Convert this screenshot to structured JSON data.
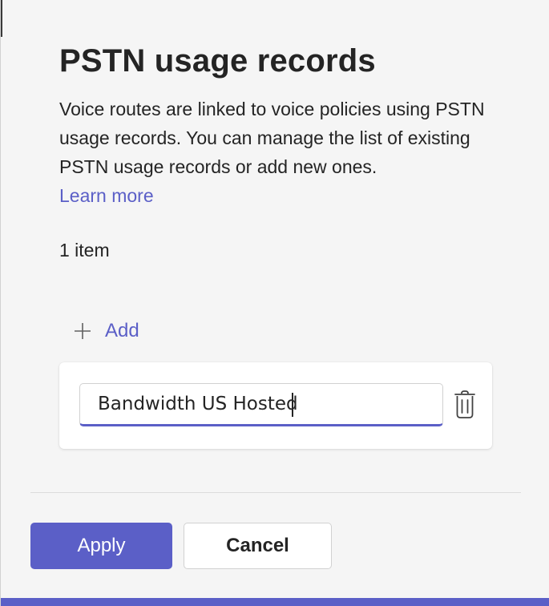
{
  "dialog": {
    "title": "PSTN usage records",
    "description": "Voice routes are linked to voice policies using PSTN usage records. You can manage the list of existing PSTN usage records or add new ones.",
    "learn_more_label": "Learn more",
    "item_count_label": "1 item"
  },
  "toolbar": {
    "add_label": "Add",
    "add_icon": "plus-icon"
  },
  "records": [
    {
      "value": "Bandwidth US Hosted",
      "delete_icon": "trash-icon"
    }
  ],
  "footer": {
    "apply_label": "Apply",
    "cancel_label": "Cancel"
  },
  "colors": {
    "accent": "#5b5fc7",
    "background": "#f5f5f5",
    "card": "#ffffff",
    "text": "#242424"
  }
}
